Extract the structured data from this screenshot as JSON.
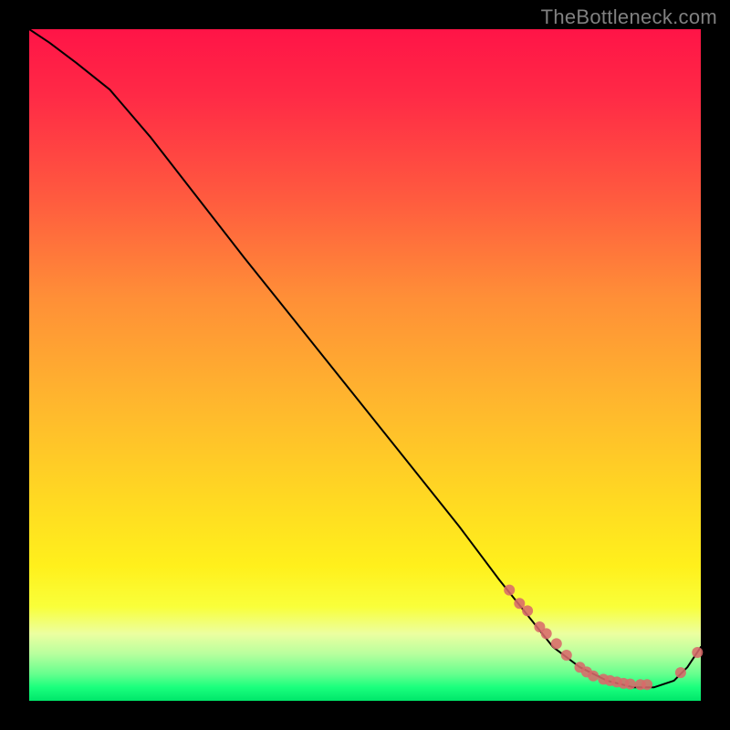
{
  "watermark": "TheBottleneck.com",
  "chart_data": {
    "type": "line",
    "title": "",
    "xlabel": "",
    "ylabel": "",
    "xlim": [
      0,
      100
    ],
    "ylim": [
      0,
      100
    ],
    "grid": false,
    "legend": false,
    "series": [
      {
        "name": "curve",
        "stroke": "#000000",
        "x": [
          0,
          3,
          7,
          12,
          18,
          25,
          32,
          40,
          48,
          56,
          64,
          70,
          74,
          78,
          82,
          86,
          90,
          93,
          96,
          98,
          100
        ],
        "y": [
          100,
          98,
          95,
          91,
          84,
          75,
          66,
          56,
          46,
          36,
          26,
          18,
          13,
          8,
          5,
          3,
          2,
          2,
          3,
          5,
          8
        ]
      }
    ],
    "markers": {
      "name": "highlight-points",
      "color": "#d86a6a",
      "radius_px": 6,
      "x": [
        71.5,
        73,
        74.2,
        76,
        77,
        78.5,
        80,
        82,
        83,
        84,
        85.5,
        86.5,
        87.5,
        88.5,
        89.5,
        91,
        92,
        97,
        99.5
      ],
      "y": [
        16.5,
        14.5,
        13.4,
        11,
        10,
        8.5,
        6.8,
        5,
        4.3,
        3.7,
        3.2,
        3,
        2.8,
        2.6,
        2.5,
        2.4,
        2.4,
        4.2,
        7.2
      ]
    }
  }
}
